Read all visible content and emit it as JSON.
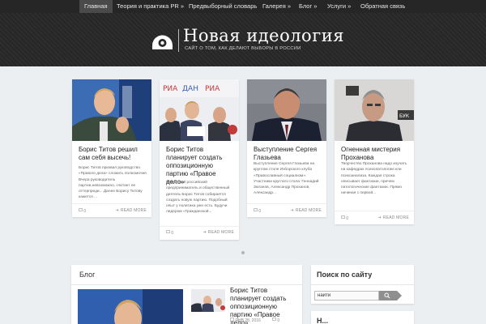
{
  "nav": {
    "items": [
      {
        "label": "Главная",
        "active": true
      },
      {
        "label": "Теория и практика PR »"
      },
      {
        "label": "Предвыборный словарь"
      },
      {
        "label": "Галерея »"
      },
      {
        "label": "Блог »"
      },
      {
        "label": "Услуги »"
      },
      {
        "label": "Обратная связь"
      }
    ]
  },
  "header": {
    "title": "Новая идеология",
    "tagline": "САЙТ О ТОМ, КАК ДЕЛАЮТ ВЫБОРЫ В РОССИИ",
    "logo_icon": "eye-logo-icon"
  },
  "featured": [
    {
      "title": "Борис Титов решил сам себя высечь!",
      "excerpt": "Борис Титов призвал руководство «Правого дела» сложить полномочия Вчера руководитель партии,невозможно, считает ее оттерпреди... Далее Борису Титову кажется ...",
      "comments": "0",
      "readmore": "READ MORE"
    },
    {
      "title": "Борис Титов планирует создать оппозиционную партию «Правое дело»",
      "excerpt": "Известный российский предприниматель и общественный деятель Борис Титов собирается создать новую партию. Подобный опыт у политика уже есть. Будучи лидером «Гражданской...",
      "comments": "0",
      "readmore": "READ MORE"
    },
    {
      "title": "Выступление Сергея Глазьева",
      "excerpt": "Выступление Сергея Глазьева на круглом столе Изборского клуба «Православный социализм». Участники круглого стола: Геннадий Зюганов, Александр Проханов, Александр...",
      "comments": "0",
      "readmore": "READ MORE"
    },
    {
      "title": "Огненная мистерия Проханова",
      "excerpt": "Творчество Проханова надо изучать на кафедрах психопатологии или психоанализа. Каждая строка описывает фантазии, причем патологические фантазии. Прямо начиная с первой...",
      "comments": "0",
      "readmore": "READ MORE"
    }
  ],
  "blog": {
    "heading": "Блог",
    "post_title": "Борис Титов планирует создать оппозиционную партию «Правое дело»",
    "post_date": "ЯНВ 28, 2016",
    "post_comments": "0"
  },
  "sidebar": {
    "search_heading": "Поиск по сайту",
    "search_value": "найти",
    "widget2_heading": "Н..."
  },
  "colors": {
    "nav_bg": "#262626",
    "header_bg": "#2a2a2a",
    "page_bg": "#eceff2",
    "search_button": "#8f8f8f"
  }
}
